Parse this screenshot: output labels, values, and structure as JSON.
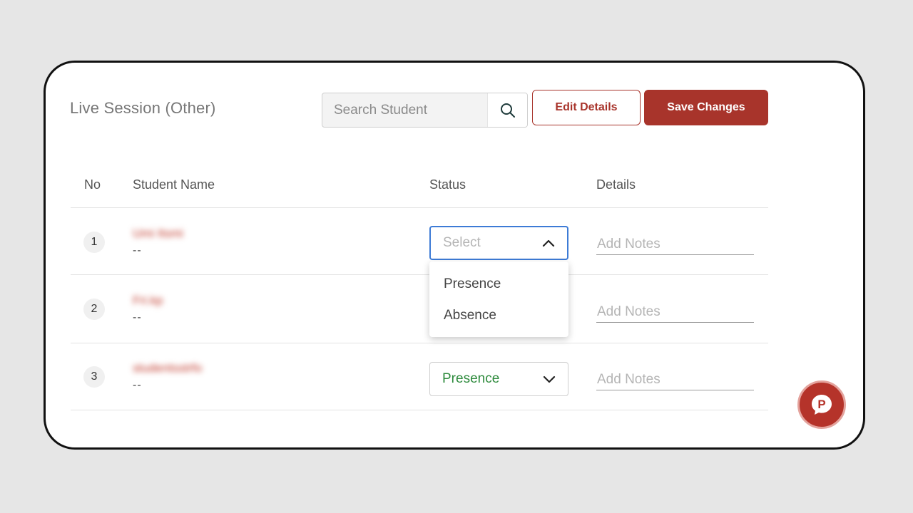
{
  "header": {
    "title": "Live Session (Other)",
    "search_placeholder": "Search Student",
    "edit_label": "Edit Details",
    "save_label": "Save Changes"
  },
  "table": {
    "columns": [
      "No",
      "Student Name",
      "Status",
      "Details"
    ],
    "rows": [
      {
        "no": "1",
        "name": "Umi Itsmi",
        "sub": "--",
        "status": "Select",
        "notes_placeholder": "Add Notes",
        "dropdown_open": true
      },
      {
        "no": "2",
        "name": "Fri.kp",
        "sub": "--",
        "status": "",
        "notes_placeholder": "Add Notes",
        "dropdown_open": false
      },
      {
        "no": "3",
        "name": "studentsstrfo",
        "sub": "--",
        "status": "Presence",
        "notes_placeholder": "Add Notes",
        "dropdown_open": false
      }
    ]
  },
  "dropdown": {
    "options": [
      "Presence",
      "Absence"
    ]
  },
  "colors": {
    "accent": "#a8342b",
    "focus": "#3d7bd6",
    "presence": "#2e8b3d"
  },
  "icons": {
    "search": "search-icon",
    "chevron_up": "chevron-up-icon",
    "chevron_down": "chevron-down-icon",
    "chat": "chat-logo-icon"
  }
}
